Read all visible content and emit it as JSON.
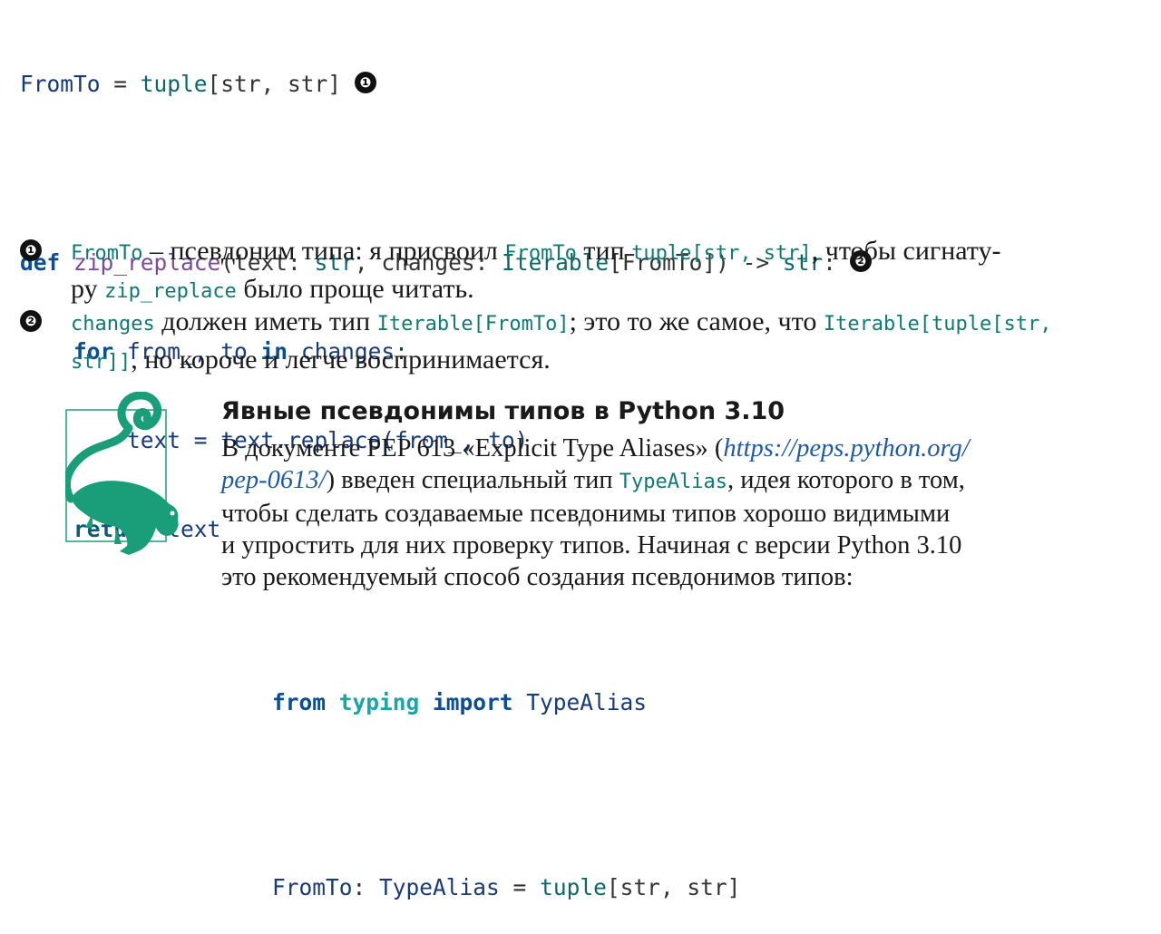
{
  "code_top": {
    "line1": {
      "ident": "FromTo",
      "eq": " = ",
      "type": "tuple",
      "args": "[str, str]",
      "badge": "❶"
    },
    "line2": {
      "kw": "def",
      "fn": "zip_replace",
      "params1": "(text: ",
      "str1": "str",
      "comma": ", changes: ",
      "iter": "Iterable",
      "tail": "[FromTo]) -> ",
      "ret": "str",
      "colon": ":",
      "badge": "❷"
    },
    "line3": {
      "kw_for": "for",
      "vars": " from_, to ",
      "kw_in": "in",
      "rest": " changes:"
    },
    "line4": {
      "text": "text = text.replace(from_, to)"
    },
    "line5": {
      "kw": "return",
      "rest": " text"
    }
  },
  "callouts": [
    {
      "badge": "❶",
      "l1_code": "FromTo",
      "l1_a": " – псевдоним типа: я присвоил ",
      "l1_code2": "FromTo",
      "l1_b": " тип ",
      "l1_code3": "tuple[str, str]",
      "l1_c": ", чтобы сигнату-",
      "l2_a": "ру ",
      "l2_code": "zip_replace",
      "l2_b": " было проще читать."
    },
    {
      "badge": "❷",
      "l1_code": "changes",
      "l1_a": " должен иметь тип ",
      "l1_code2": "Iterable[FromTo]",
      "l1_b": "; это то же самое, что ",
      "l1_code3": "Iterable[tuple[str,",
      "l2_code": "str]]",
      "l2_a": ", но короче и легче воспринимается."
    }
  ],
  "sidebar": {
    "title": "Явные псевдонимы типов в Python 3.10",
    "l1_a": "В документе PEP 613 «Explicit Type Aliases» (",
    "l1_link": "https://peps.python.org/",
    "l2_link": "pep-0613/",
    "l2_a": ") введен специальный тип ",
    "l2_code": "TypeAlias",
    "l2_b": ", идея которого в том,",
    "l3": "чтобы сделать создаваемые псевдонимы типов хорошо видимыми",
    "l4": "и упростить для них проверку типов. Начиная с версии Python 3.10",
    "l5": "это рекомендуемый способ создания псевдонимов типов:"
  },
  "code_bottom": {
    "line1": {
      "from": "from",
      "mod": " typing ",
      "imp": "import",
      "name": " TypeAlias"
    },
    "line2": {
      "ident": "FromTo",
      "colon": ": ",
      "alias": "TypeAlias",
      "eq": " = ",
      "type": "tuple",
      "args": "[str, str]"
    }
  },
  "colors": {
    "keyword": "#0a4f96",
    "inline_code": "#0f7a74",
    "link": "#1f5aa6",
    "lemur": "#1a9e7a"
  }
}
